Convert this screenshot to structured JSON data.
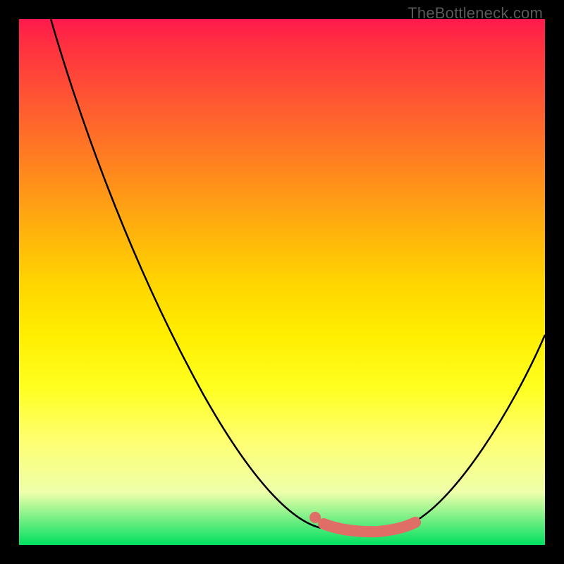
{
  "watermark": "TheBottleneck.com",
  "chart_data": {
    "type": "line",
    "title": "",
    "xlabel": "",
    "ylabel": "",
    "xlim": [
      0,
      100
    ],
    "ylim": [
      0,
      100
    ],
    "series": [
      {
        "name": "bottleneck-curve",
        "x": [
          6,
          10,
          15,
          20,
          25,
          30,
          35,
          40,
          45,
          50,
          55,
          58,
          62,
          66,
          70,
          75,
          80,
          85,
          90,
          95,
          100
        ],
        "y": [
          100,
          92,
          83,
          74,
          65,
          56,
          47,
          38,
          29,
          20,
          11,
          5,
          2,
          1,
          1,
          2,
          7,
          14,
          22,
          31,
          40
        ],
        "color": "#000000"
      },
      {
        "name": "highlight-band",
        "x": [
          58,
          62,
          66,
          70,
          73
        ],
        "y": [
          5,
          2,
          1,
          1,
          2
        ],
        "color": "#e07066"
      }
    ],
    "annotations": []
  },
  "colors": {
    "background": "#000000",
    "gradient_top": "#ff1a4d",
    "gradient_bottom": "#00e060",
    "curve": "#000000",
    "highlight": "#e07066",
    "watermark": "#5a5a5a"
  }
}
